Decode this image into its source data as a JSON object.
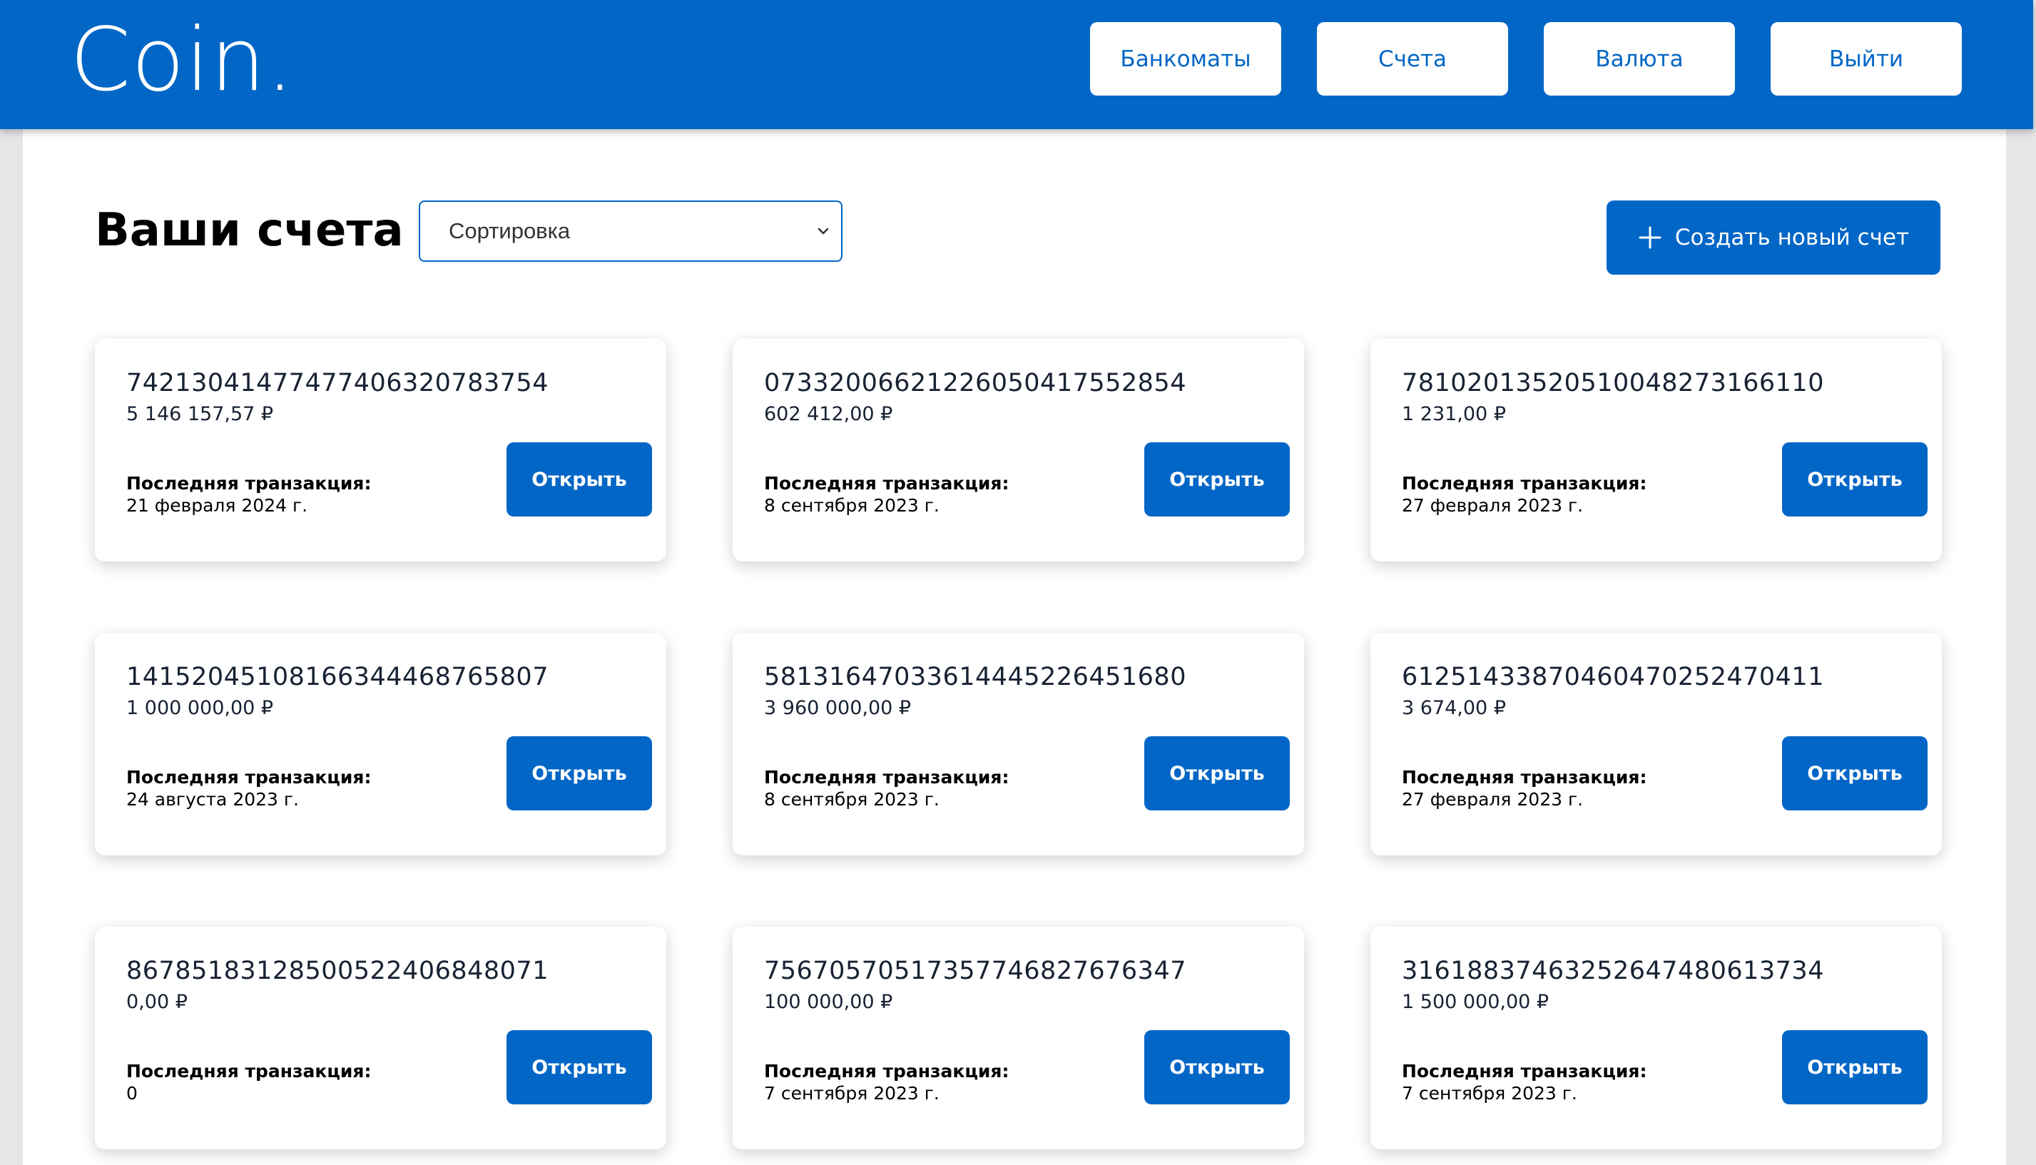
{
  "header": {
    "logo": "Coin.",
    "nav": [
      "Банкоматы",
      "Счета",
      "Валюта",
      "Выйти"
    ]
  },
  "main": {
    "title": "Ваши счета",
    "sort_label": "Сортировка",
    "create_label": "Создать новый счет",
    "last_transaction_label": "Последняя транзакция:",
    "open_label": "Открыть",
    "accounts": [
      {
        "number": "74213041477477406320783754",
        "balance": "5 146 157,57 ₽",
        "date": "21 февраля 2024 г."
      },
      {
        "number": "07332006621226050417552854",
        "balance": "602 412,00 ₽",
        "date": "8 сентября 2023 г."
      },
      {
        "number": "78102013520510048273166110",
        "balance": "1 231,00 ₽",
        "date": "27 февраля 2023 г."
      },
      {
        "number": "14152045108166344468765807",
        "balance": "1 000 000,00 ₽",
        "date": "24 августа 2023 г."
      },
      {
        "number": "58131647033614445226451680",
        "balance": "3 960 000,00 ₽",
        "date": "8 сентября 2023 г."
      },
      {
        "number": "61251433870460470252470411",
        "balance": "3 674,00 ₽",
        "date": "27 февраля 2023 г."
      },
      {
        "number": "86785183128500522406848071",
        "balance": "0,00 ₽",
        "date": "0"
      },
      {
        "number": "75670570517357746827676347",
        "balance": "100 000,00 ₽",
        "date": "7 сентября 2023 г."
      },
      {
        "number": "31618837463252647480613734",
        "balance": "1 500 000,00 ₽",
        "date": "7 сентября 2023 г."
      }
    ]
  },
  "colors": {
    "brand": "#0166c6",
    "background": "#ffffff",
    "outer": "#e6e6e6"
  }
}
